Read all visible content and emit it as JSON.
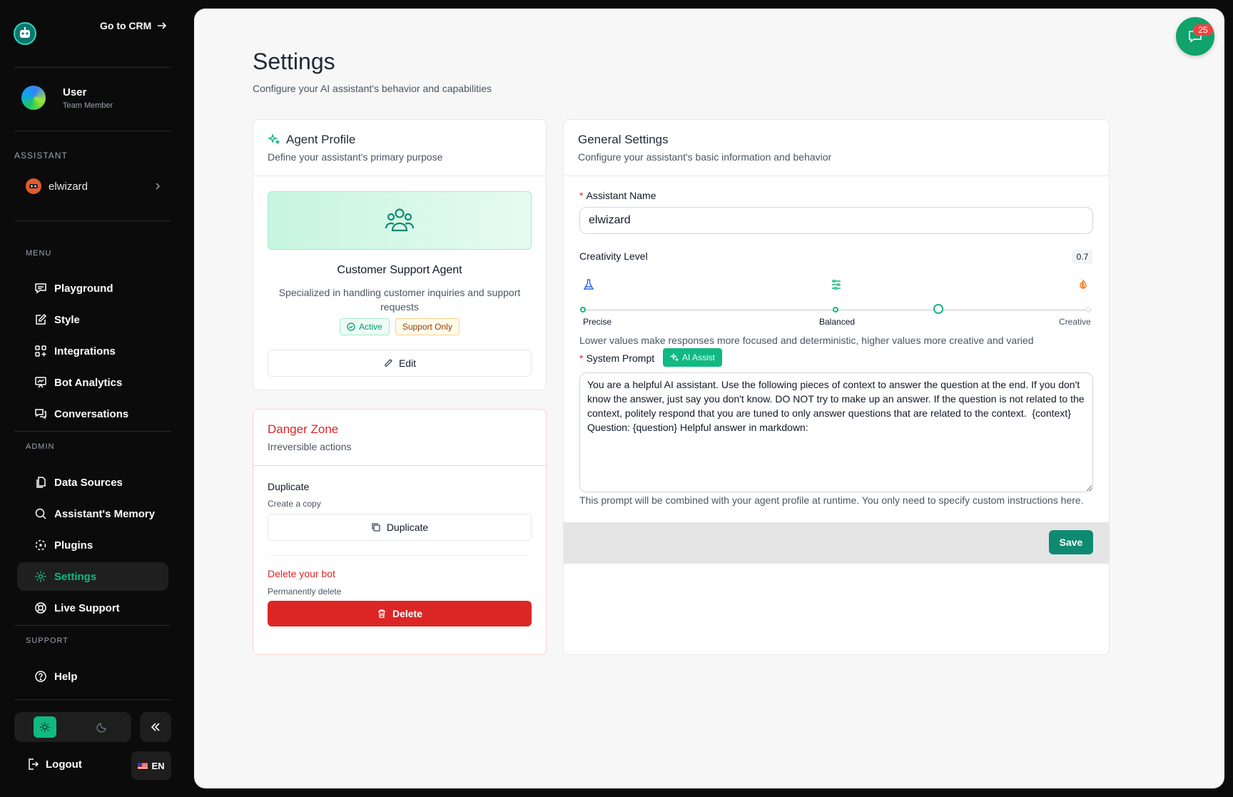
{
  "sidebar": {
    "goto_crm": "Go to CRM",
    "user": {
      "name": "User",
      "role": "Team Member"
    },
    "assistant_section": "ASSISTANT",
    "assistant_name": "elwizard",
    "menu_section": "MENU",
    "menu": [
      {
        "label": "Playground",
        "icon": "chat-bubble-icon"
      },
      {
        "label": "Style",
        "icon": "pencil-square-icon"
      },
      {
        "label": "Integrations",
        "icon": "grid-plus-icon"
      },
      {
        "label": "Bot Analytics",
        "icon": "chart-board-icon"
      },
      {
        "label": "Conversations",
        "icon": "chat-bubbles-icon"
      }
    ],
    "admin_section": "ADMIN",
    "admin": [
      {
        "label": "Data Sources",
        "icon": "files-icon"
      },
      {
        "label": "Assistant's Memory",
        "icon": "search-icon"
      },
      {
        "label": "Plugins",
        "icon": "dashed-circle-icon"
      },
      {
        "label": "Settings",
        "icon": "gear-icon",
        "active": true
      },
      {
        "label": "Live Support",
        "icon": "lifebuoy-icon"
      }
    ],
    "support_section": "SUPPORT",
    "support": [
      {
        "label": "Help",
        "icon": "question-circle-icon"
      }
    ],
    "logout": "Logout",
    "language": "EN"
  },
  "page": {
    "title": "Settings",
    "subtitle": "Configure your AI assistant's behavior and capabilities"
  },
  "agent_profile": {
    "title": "Agent Profile",
    "subtitle": "Define your assistant's primary purpose",
    "agent_name": "Customer Support Agent",
    "agent_desc": "Specialized in handling customer inquiries and support requests",
    "badge_active": "Active",
    "badge_support": "Support Only",
    "edit": "Edit"
  },
  "danger_zone": {
    "title": "Danger Zone",
    "subtitle": "Irreversible actions",
    "duplicate_label": "Duplicate",
    "duplicate_sub": "Create a copy",
    "duplicate_button": "Duplicate",
    "delete_label": "Delete your bot",
    "delete_sub": "Permanently delete",
    "delete_button": "Delete"
  },
  "general": {
    "title": "General Settings",
    "subtitle": "Configure your assistant's basic information and behavior",
    "name_label": "Assistant Name",
    "name_value": "elwizard",
    "creativity_label": "Creativity Level",
    "creativity_value": "0.7",
    "creativity_fraction": 0.7,
    "tick_precise": "Precise",
    "tick_balanced": "Balanced",
    "tick_creative": "Creative",
    "creativity_help": "Lower values make responses more focused and deterministic, higher values more creative and varied",
    "prompt_label": "System Prompt",
    "ai_assist": "AI Assist",
    "prompt_value": "You are a helpful AI assistant. Use the following pieces of context to answer the question at the end. If you don't know the answer, just say you don't know. DO NOT try to make up an answer. If the question is not related to the context, politely respond that you are tuned to only answer questions that are related to the context.  {context}  Question: {question} Helpful answer in markdown:",
    "prompt_help": "This prompt will be combined with your agent profile at runtime. You only need to specify custom instructions here.",
    "save": "Save"
  },
  "notifications": {
    "count": "25"
  },
  "colors": {
    "accent": "#10b981",
    "danger": "#dc2626",
    "save": "#0f8a72",
    "sidebar_bg": "#0b0b0b"
  }
}
